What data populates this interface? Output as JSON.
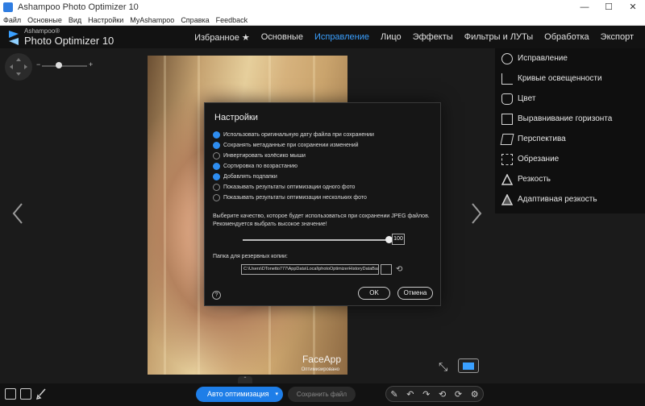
{
  "window": {
    "title": "Ashampoo Photo Optimizer 10",
    "minimize": "—",
    "maximize": "☐",
    "close": "✕"
  },
  "menu": [
    "Файл",
    "Основные",
    "Вид",
    "Настройки",
    "MyAshampoo",
    "Справка",
    "Feedback"
  ],
  "logo": {
    "brand": "Ashampoo®",
    "product": "Photo Optimizer 10"
  },
  "nav": [
    {
      "label": "Избранное ★",
      "active": false
    },
    {
      "label": "Основные",
      "active": false
    },
    {
      "label": "Исправление",
      "active": true
    },
    {
      "label": "Лицо",
      "active": false
    },
    {
      "label": "Эффекты",
      "active": false
    },
    {
      "label": "Фильтры и ЛУТы",
      "active": false
    },
    {
      "label": "Обработка",
      "active": false
    },
    {
      "label": "Экспорт",
      "active": false
    }
  ],
  "zoom": {
    "minus": "−",
    "plus": "+"
  },
  "right_panel": [
    {
      "label": "Исправление",
      "icon": "sun-icon"
    },
    {
      "label": "Кривые освещенности",
      "icon": "curves-icon"
    },
    {
      "label": "Цвет",
      "icon": "palette-icon"
    },
    {
      "label": "Выравнивание горизонта",
      "icon": "horizon-icon"
    },
    {
      "label": "Перспектива",
      "icon": "perspective-icon"
    },
    {
      "label": "Обрезание",
      "icon": "crop-icon"
    },
    {
      "label": "Резкость",
      "icon": "triangle-icon"
    },
    {
      "label": "Адаптивная резкость",
      "icon": "adaptive-sharpen-icon"
    }
  ],
  "photo": {
    "watermark": "FaceApp",
    "watermark_sub": "Оптимизировано"
  },
  "dialog": {
    "title": "Настройки",
    "options": [
      {
        "label": "Использовать оригинальную дату файла при сохранении",
        "checked": true
      },
      {
        "label": "Сохранять метаданные при сохранении изменений",
        "checked": true
      },
      {
        "label": "Инвертировать колёсико мыши",
        "checked": false
      },
      {
        "label": "Сортировка по возрастанию",
        "checked": true
      },
      {
        "label": "Добавлять подпапки",
        "checked": true
      },
      {
        "label": "Показывать результаты оптимизации одного фото",
        "checked": false
      },
      {
        "label": "Показывать результаты оптимизации нескольких фото",
        "checked": false
      }
    ],
    "quality_text_1": "Выберите качество, которое будет использоваться при сохранении JPEG файлов.",
    "quality_text_2": "Рекомендуется выбрать высокое значение!",
    "quality_value": "100",
    "backup_label": "Папка для резервных копии:",
    "backup_path": "C:\\Users\\DTonetto777\\AppData\\Local\\photoOptimizerHistoryDataBase\\",
    "help": "?",
    "ok": "OK",
    "cancel": "Отмена"
  },
  "bottom": {
    "auto_label": "Авто оптимизация",
    "auto_dropdown": "▾",
    "save_label": "Сохранить файл",
    "expand": "⌃",
    "tools": [
      "✎",
      "↶",
      "↷",
      "⟲",
      "⟳",
      "⚙"
    ]
  }
}
